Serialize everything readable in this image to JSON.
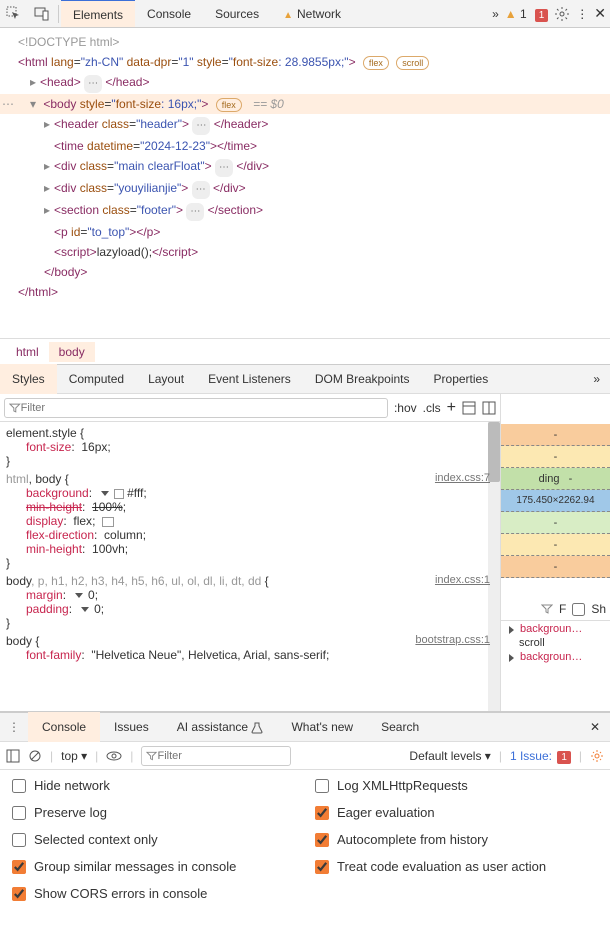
{
  "toolbar": {
    "tabs": [
      "Elements",
      "Console",
      "Sources",
      "Network"
    ],
    "active": 0,
    "warn_count": "1",
    "error_count": "1"
  },
  "dom": {
    "doctype": "<!DOCTYPE html>",
    "html_open": {
      "lang": "zh-CN",
      "dpr": "1",
      "font_size": "28.9855px;"
    },
    "pills": [
      "flex",
      "scroll"
    ],
    "head_open": "<head>",
    "head_close": "</head>",
    "body_open_font": "16px;",
    "body_pill": "flex",
    "body_eq": "== $0",
    "header_open": {
      "class": "header"
    },
    "header_close": "</header>",
    "time": {
      "datetime": "2024-12-23"
    },
    "time_close": "</time>",
    "div_main": {
      "class": "main clearFloat"
    },
    "div_close": "</div>",
    "div_you": {
      "class": "youyilianjie"
    },
    "section": {
      "class": "footer"
    },
    "section_close": "</section>",
    "p_top": {
      "id": "to_top"
    },
    "p_close": "</p>",
    "script_text": "lazyload();",
    "script_open": "<script>",
    "script_close_tag": "script",
    "body_close": "</body>",
    "html_close": "</html>"
  },
  "crumbs": [
    "html",
    "body"
  ],
  "sub_tabs": [
    "Styles",
    "Computed",
    "Layout",
    "Event Listeners",
    "DOM Breakpoints",
    "Properties"
  ],
  "styles_toolbar": {
    "filter_placeholder": "Filter",
    "hov": ":hov",
    "cls": ".cls"
  },
  "styles": {
    "rule1": {
      "sel": "element.style",
      "props": [
        {
          "n": "font-size",
          "v": "16px"
        }
      ]
    },
    "rule2": {
      "sel_a": "html",
      "sel_b": "body",
      "src": "index.css:7",
      "props": [
        {
          "n": "background",
          "v": "#fff",
          "swatch": true,
          "tri": true
        },
        {
          "n": "min-height",
          "v": "100%",
          "struck": true
        },
        {
          "n": "display",
          "v": "flex",
          "flex": true
        },
        {
          "n": "flex-direction",
          "v": "column"
        },
        {
          "n": "min-height",
          "v": "100vh"
        }
      ]
    },
    "rule3": {
      "sel": "body, p, h1, h2, h3, h4, h5, h6, ul, ol, dl, li, dt, dd",
      "src": "index.css:1",
      "props": [
        {
          "n": "margin",
          "v": "0",
          "tri": true
        },
        {
          "n": "padding",
          "v": "0",
          "tri": true
        }
      ]
    },
    "rule4": {
      "sel": "body",
      "src": "bootstrap.css:1",
      "props": [
        {
          "n": "font-family",
          "v": "\"Helvetica Neue\", Helvetica, Arial, sans-serif"
        }
      ]
    }
  },
  "box_model": {
    "content": "175.450×2262.94",
    "dashes": [
      "-",
      "-",
      "-",
      "-",
      "-",
      "-"
    ],
    "label": "ding"
  },
  "comp_filter": {
    "f": "F",
    "sh": "Sh"
  },
  "comp_items": [
    {
      "n": "backgroun…",
      "sub": "scroll"
    },
    {
      "n": "backgroun…"
    }
  ],
  "drawer": {
    "tabs": [
      "Console",
      "Issues",
      "AI assistance",
      "What's new",
      "Search"
    ],
    "active": 0
  },
  "console_bar": {
    "ctx": "top",
    "filter_placeholder": "Filter",
    "levels": "Default levels",
    "issue_label": "1 Issue:",
    "issue_count": "1"
  },
  "settings": {
    "left": [
      {
        "label": "Hide network",
        "checked": false
      },
      {
        "label": "Preserve log",
        "checked": false
      },
      {
        "label": "Selected context only",
        "checked": false
      },
      {
        "label": "Group similar messages in console",
        "checked": true
      },
      {
        "label": "Show CORS errors in console",
        "checked": true
      }
    ],
    "right": [
      {
        "label": "Log XMLHttpRequests",
        "checked": false
      },
      {
        "label": "Eager evaluation",
        "checked": true
      },
      {
        "label": "Autocomplete from history",
        "checked": true
      },
      {
        "label": "Treat code evaluation as user action",
        "checked": true
      }
    ]
  }
}
